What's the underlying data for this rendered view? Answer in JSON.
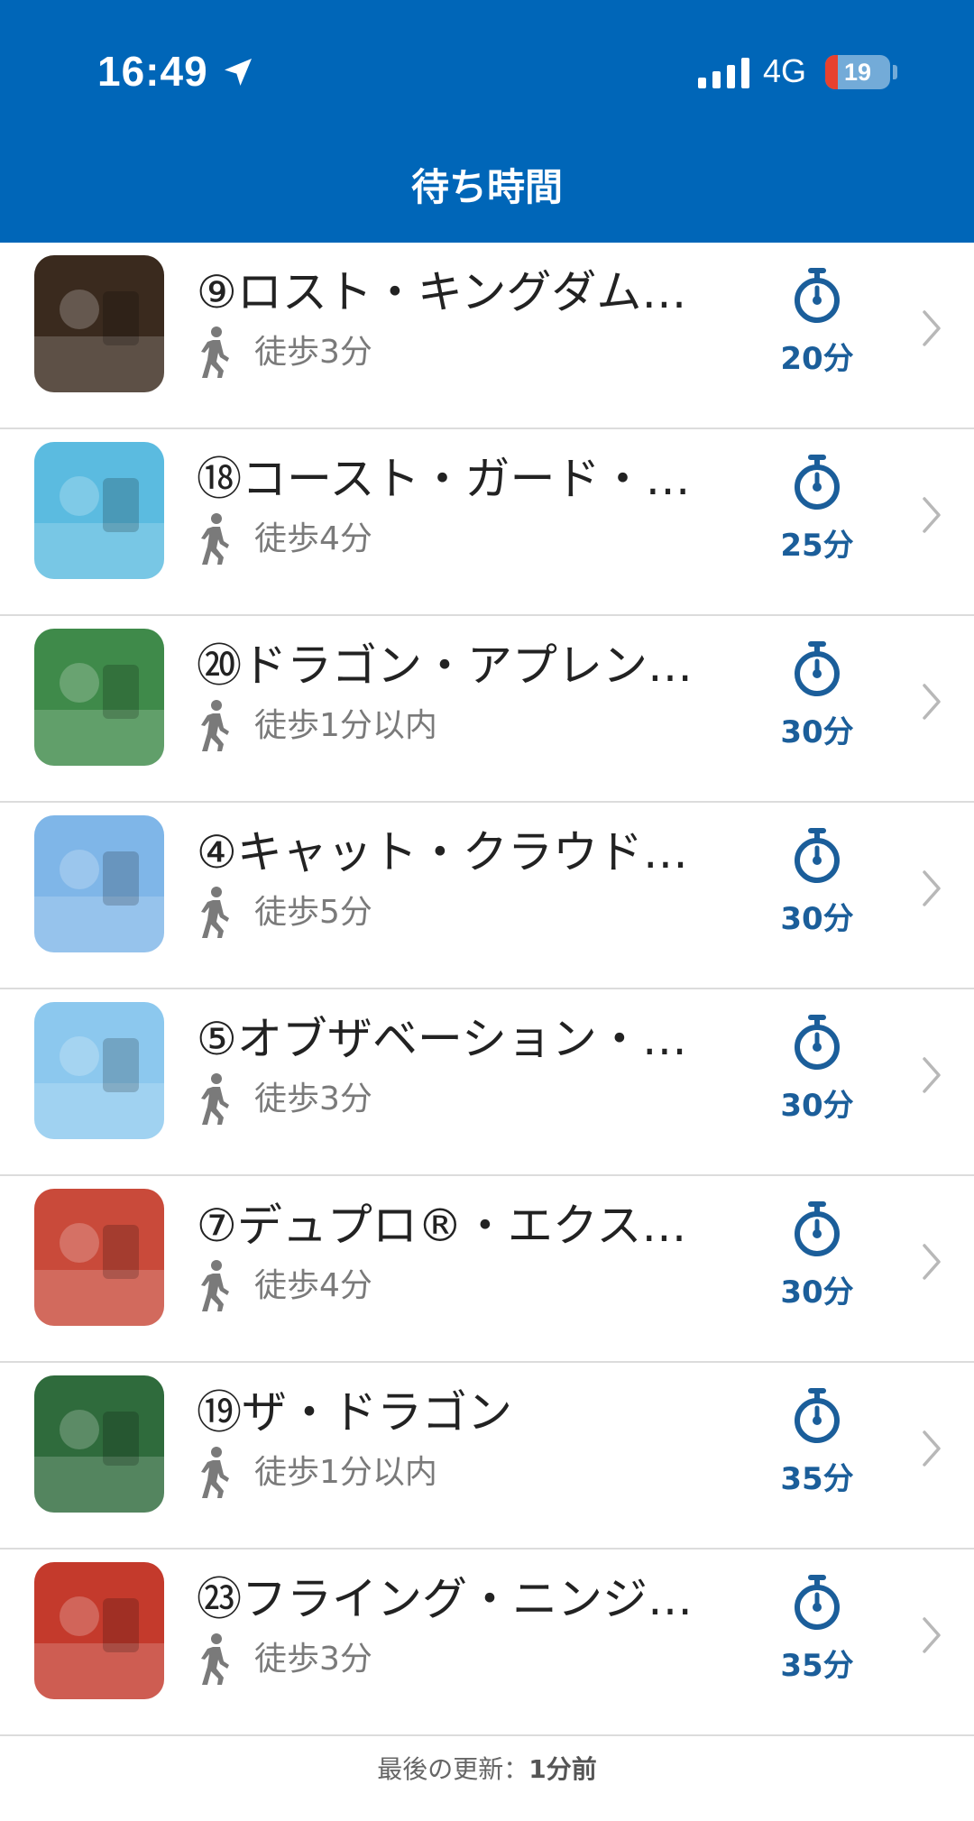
{
  "status_bar": {
    "time": "16:49",
    "network": "4G",
    "battery": "19",
    "battery_level": 0.19
  },
  "header": {
    "title": "待ち時間"
  },
  "rides": [
    {
      "name": "⑨ロスト・キングダム…",
      "walk": "徒歩3分",
      "wait": "20分",
      "thumb_color": "#3a2a1e"
    },
    {
      "name": "⑱コースト・ガード・…",
      "walk": "徒歩4分",
      "wait": "25分",
      "thumb_color": "#5bbbe0"
    },
    {
      "name": "⑳ドラゴン・アプレン…",
      "walk": "徒歩1分以内",
      "wait": "30分",
      "thumb_color": "#3f8a4a"
    },
    {
      "name": "④キャット・クラウド…",
      "walk": "徒歩5分",
      "wait": "30分",
      "thumb_color": "#7fb6e8"
    },
    {
      "name": "⑤オブザベーション・…",
      "walk": "徒歩3分",
      "wait": "30分",
      "thumb_color": "#8cc8ee"
    },
    {
      "name": "⑦デュプロ®・エクス…",
      "walk": "徒歩4分",
      "wait": "30分",
      "thumb_color": "#c94a3a"
    },
    {
      "name": "⑲ザ・ドラゴン",
      "walk": "徒歩1分以内",
      "wait": "35分",
      "thumb_color": "#2f6b3c"
    },
    {
      "name": "㉓フライング・ニンジ…",
      "walk": "徒歩3分",
      "wait": "35分",
      "thumb_color": "#c43a2c"
    }
  ],
  "footer": {
    "label": "最後の更新：",
    "value": "1分前"
  },
  "colors": {
    "header_bg": "#0066b8",
    "accent": "#1b5e9a"
  }
}
